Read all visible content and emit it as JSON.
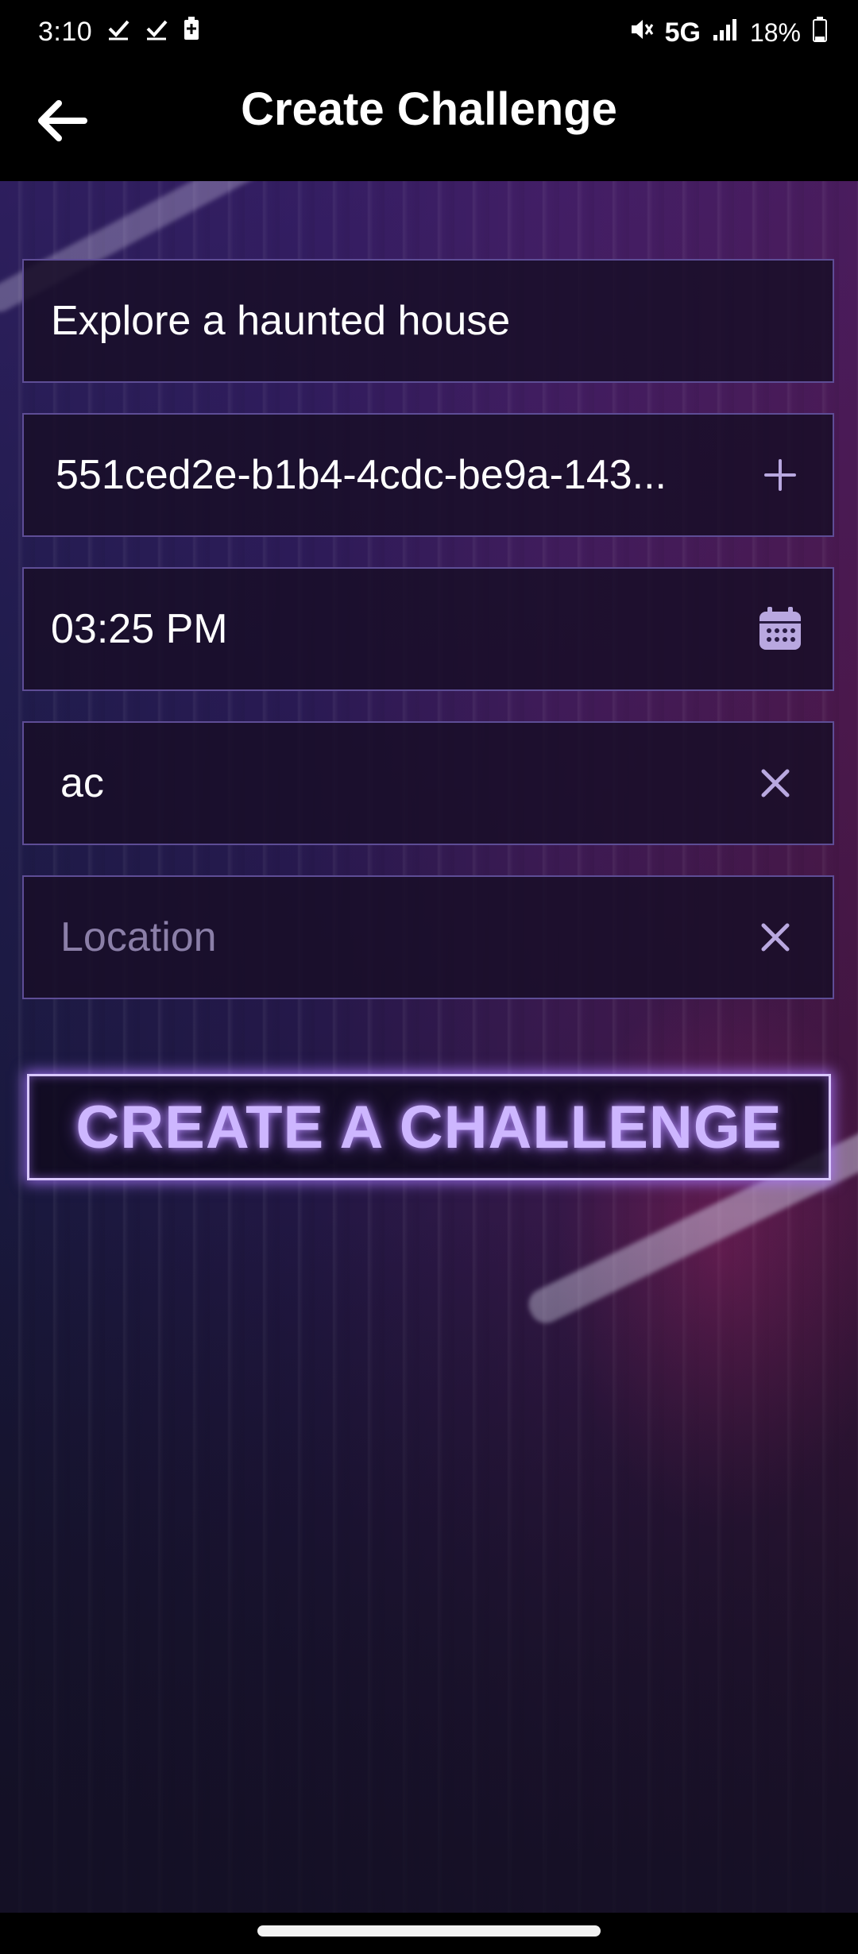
{
  "status_bar": {
    "time": "3:10",
    "network": "5G",
    "battery": "18%"
  },
  "app_bar": {
    "title": "Create Challenge"
  },
  "form": {
    "challenge_name": {
      "value": "Explore a haunted house"
    },
    "participant_id": {
      "value": "551ced2e-b1b4-4cdc-be9a-143..."
    },
    "time": {
      "value": "03:25 PM"
    },
    "category": {
      "value": "ac"
    },
    "location": {
      "value": "",
      "placeholder": "Location"
    }
  },
  "create_button": {
    "label": "CREATE A CHALLENGE"
  },
  "colors": {
    "field_border": "#5e4d96",
    "button_glow": "#cdb6ff",
    "icon_color": "#b9a8e0"
  },
  "icons": {
    "back": "arrow-left-icon",
    "add": "plus-icon",
    "calendar": "calendar-icon",
    "clear": "close-icon"
  }
}
